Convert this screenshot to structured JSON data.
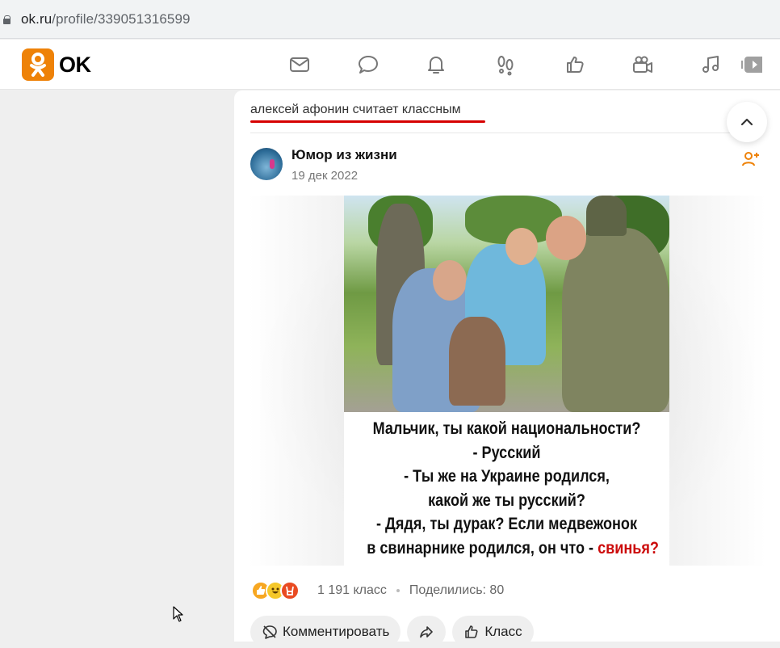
{
  "browser": {
    "url_host": "ok.ru",
    "url_path": "/profile/339051316599"
  },
  "header": {
    "logo_text": "OK",
    "brand_color": "#ee8208",
    "nav_icons": [
      "mail-icon",
      "chat-bubble-icon",
      "bell-icon",
      "guests-footprints-icon",
      "like-thumb-icon",
      "video-camera-icon",
      "music-note-icon",
      "video-play-icon"
    ]
  },
  "feed": {
    "reshare_text": "алексей афонин считает классным",
    "post": {
      "group_name": "Юмор из жизни",
      "date": "19 дек 2022",
      "caption_lines": [
        "Мальчик, ты какой национальности?",
        "- Русский",
        "- Ты же на Украине родился,",
        "какой же ты русский?",
        "- Дядя, ты дурак? Если медвежонок",
        "в свинарнике родился, он что -"
      ],
      "caption_highlight": "свинья?",
      "highlight_color": "#cc0b0b",
      "reactions_count": "1 191 класс",
      "shares": "Поделились: 80"
    },
    "actions": {
      "comment_label": "Комментировать",
      "like_label": "Класс"
    }
  }
}
